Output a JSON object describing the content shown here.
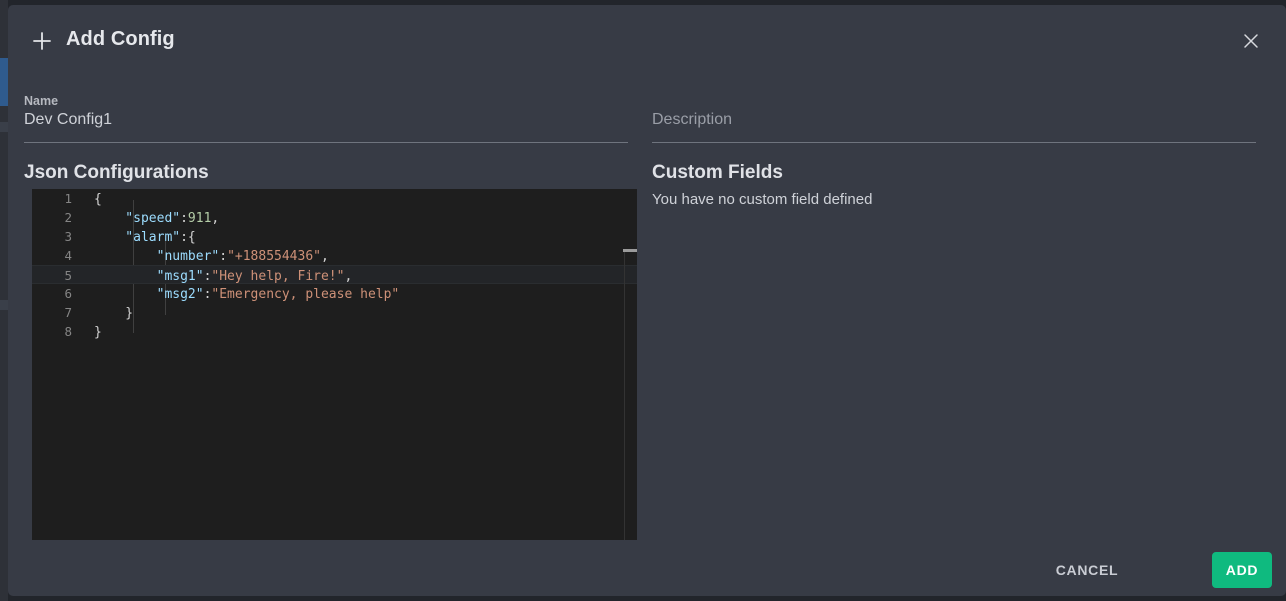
{
  "window": {
    "background": "#22252b",
    "modal_background": "#373b45"
  },
  "sidebar": {
    "active_color": "#2f5b8e"
  },
  "header": {
    "add_icon": "plus-icon",
    "title": "Add Config",
    "close_icon": "close-icon"
  },
  "form": {
    "name": {
      "label": "Name",
      "value": "Dev Config1",
      "placeholder": "Name"
    },
    "description": {
      "label": "Description",
      "value": "",
      "placeholder": "Description"
    }
  },
  "left_section": {
    "title": "Json Configurations"
  },
  "right_section": {
    "title": "Custom Fields",
    "empty_message": "You have no custom field defined"
  },
  "editor": {
    "background": "#1e1e1e",
    "active_line": 5,
    "language": "json",
    "colors": {
      "key": "#9cdcfe",
      "string": "#ce9178",
      "number": "#b5cea8",
      "punctuation": "#d4d4d4",
      "line_number": "#858585"
    },
    "lines": [
      {
        "num": "1",
        "tokens": [
          {
            "t": "{",
            "c": "tok-punc"
          }
        ]
      },
      {
        "num": "2",
        "tokens": [
          {
            "t": "    \"speed\"",
            "c": "tok-key"
          },
          {
            "t": ":",
            "c": "tok-punc"
          },
          {
            "t": "911",
            "c": "tok-num"
          },
          {
            "t": ",",
            "c": "tok-punc"
          }
        ]
      },
      {
        "num": "3",
        "tokens": [
          {
            "t": "    \"alarm\"",
            "c": "tok-key"
          },
          {
            "t": ":{",
            "c": "tok-punc"
          }
        ]
      },
      {
        "num": "4",
        "tokens": [
          {
            "t": "        \"number\"",
            "c": "tok-key"
          },
          {
            "t": ":",
            "c": "tok-punc"
          },
          {
            "t": "\"+188554436\"",
            "c": "tok-str"
          },
          {
            "t": ",",
            "c": "tok-punc"
          }
        ]
      },
      {
        "num": "5",
        "tokens": [
          {
            "t": "        \"msg1\"",
            "c": "tok-key"
          },
          {
            "t": ":",
            "c": "tok-punc"
          },
          {
            "t": "\"Hey help, Fire!\"",
            "c": "tok-str"
          },
          {
            "t": ",",
            "c": "tok-punc"
          }
        ]
      },
      {
        "num": "6",
        "tokens": [
          {
            "t": "        \"msg2\"",
            "c": "tok-key"
          },
          {
            "t": ":",
            "c": "tok-punc"
          },
          {
            "t": "\"Emergency, please help\"",
            "c": "tok-str"
          }
        ]
      },
      {
        "num": "7",
        "tokens": [
          {
            "t": "    }",
            "c": "tok-punc"
          }
        ]
      },
      {
        "num": "8",
        "tokens": [
          {
            "t": "}",
            "c": "tok-punc"
          }
        ]
      }
    ]
  },
  "footer": {
    "cancel_label": "CANCEL",
    "add_label": "ADD",
    "add_color": "#0fba7f"
  }
}
